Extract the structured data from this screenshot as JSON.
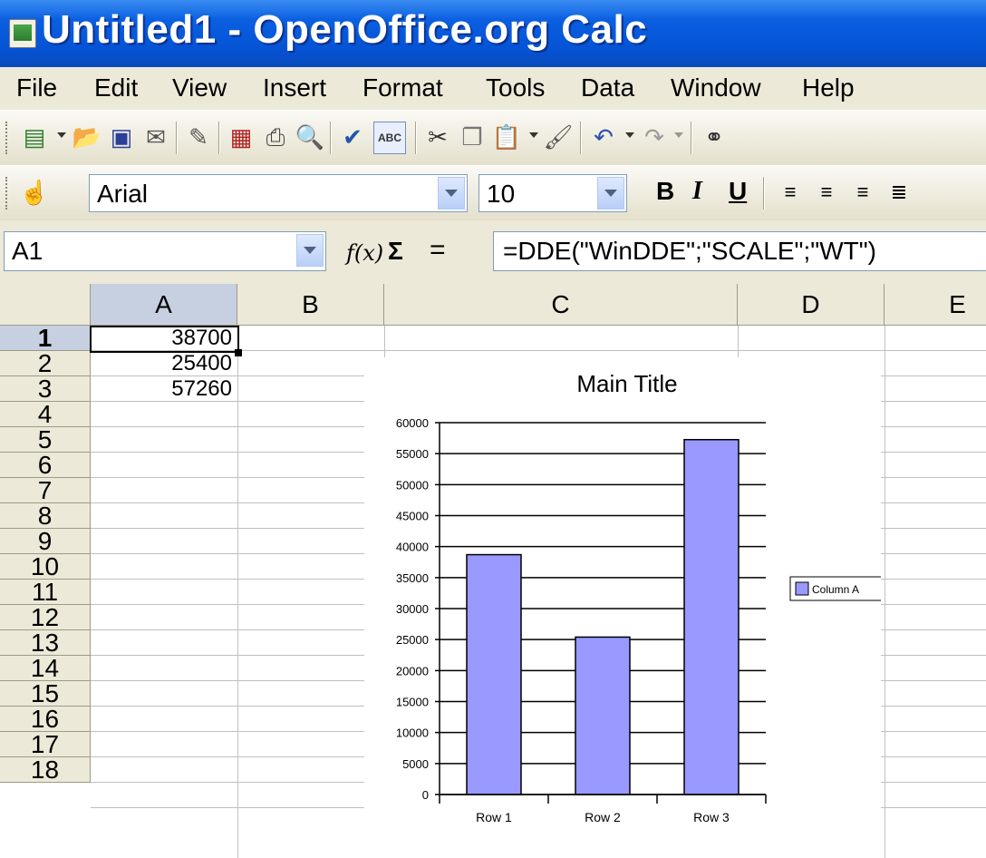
{
  "window": {
    "title": "Untitled1 - OpenOffice.org Calc"
  },
  "menu": {
    "items": [
      "File",
      "Edit",
      "View",
      "Insert",
      "Format",
      "Tools",
      "Data",
      "Window",
      "Help"
    ]
  },
  "toolbar_icons": [
    "new-icon",
    "open-icon",
    "save-icon",
    "email-icon",
    "edit-file-icon",
    "export-pdf-icon",
    "print-icon",
    "page-preview-icon",
    "spellcheck-icon",
    "autospellcheck-icon",
    "cut-icon",
    "copy-icon",
    "paste-icon",
    "clone-formatting-icon",
    "undo-icon",
    "redo-icon",
    "hyperlink-icon"
  ],
  "formatting": {
    "font_name": "Arial",
    "font_size": "10",
    "bold": "B",
    "italic": "I",
    "underline": "U"
  },
  "formula_bar": {
    "name_box": "A1",
    "formula": "=DDE(\"WinDDE\";\"SCALE\";\"WT\")",
    "fx": "f(x)",
    "sum": "Σ",
    "equals": "="
  },
  "sheet": {
    "columns": [
      "A",
      "B",
      "C",
      "D",
      "E"
    ],
    "rows": [
      "1",
      "2",
      "3",
      "4",
      "5",
      "6",
      "7",
      "8",
      "9",
      "10",
      "11",
      "12",
      "13",
      "14",
      "15",
      "16",
      "17",
      "18"
    ],
    "cells": {
      "A1": "38700",
      "A2": "25400",
      "A3": "57260"
    },
    "active_cell": "A1"
  },
  "chart_data": {
    "type": "bar",
    "title": "Main Title",
    "categories": [
      "Row 1",
      "Row 2",
      "Row 3"
    ],
    "series": [
      {
        "name": "Column A",
        "values": [
          38700,
          25400,
          57260
        ],
        "color": "#9999ff"
      }
    ],
    "ylim": [
      0,
      60000
    ],
    "yticks": [
      0,
      5000,
      10000,
      15000,
      20000,
      25000,
      30000,
      35000,
      40000,
      45000,
      50000,
      55000,
      60000
    ],
    "grid": true,
    "legend": "right"
  }
}
